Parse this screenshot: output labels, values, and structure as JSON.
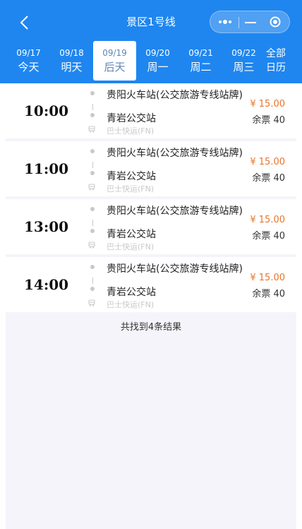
{
  "header": {
    "title": "景区1号线",
    "back_icon": "chevron-left-icon",
    "capsule_icons": [
      "more-dots-icon",
      "minimize-icon",
      "target-icon"
    ]
  },
  "dates": [
    {
      "date": "09/17",
      "weekday": "今天",
      "selected": false
    },
    {
      "date": "09/18",
      "weekday": "明天",
      "selected": false
    },
    {
      "date": "09/19",
      "weekday": "后天",
      "selected": true
    },
    {
      "date": "09/20",
      "weekday": "周一",
      "selected": false
    },
    {
      "date": "09/21",
      "weekday": "周二",
      "selected": false
    },
    {
      "date": "09/22",
      "weekday": "周三",
      "selected": false
    }
  ],
  "all_dates": {
    "line1": "全部",
    "line2": "日历"
  },
  "trips": [
    {
      "time": "10:00",
      "from": "贵阳火车站(公交旅游专线站牌)",
      "to": "青岩公交站",
      "operator": "巴士快运(FN)",
      "price": "¥ 15.00",
      "seats": "余票 40"
    },
    {
      "time": "11:00",
      "from": "贵阳火车站(公交旅游专线站牌)",
      "to": "青岩公交站",
      "operator": "巴士快运(FN)",
      "price": "¥ 15.00",
      "seats": "余票 40"
    },
    {
      "time": "13:00",
      "from": "贵阳火车站(公交旅游专线站牌)",
      "to": "青岩公交站",
      "operator": "巴士快运(FN)",
      "price": "¥ 15.00",
      "seats": "余票 40"
    },
    {
      "time": "14:00",
      "from": "贵阳火车站(公交旅游专线站牌)",
      "to": "青岩公交站",
      "operator": "巴士快运(FN)",
      "price": "¥ 15.00",
      "seats": "余票 40"
    }
  ],
  "result_text": "共找到4条结果",
  "colors": {
    "header": "#1f86f0",
    "price": "#e8762b",
    "background": "#f5f4fa"
  }
}
